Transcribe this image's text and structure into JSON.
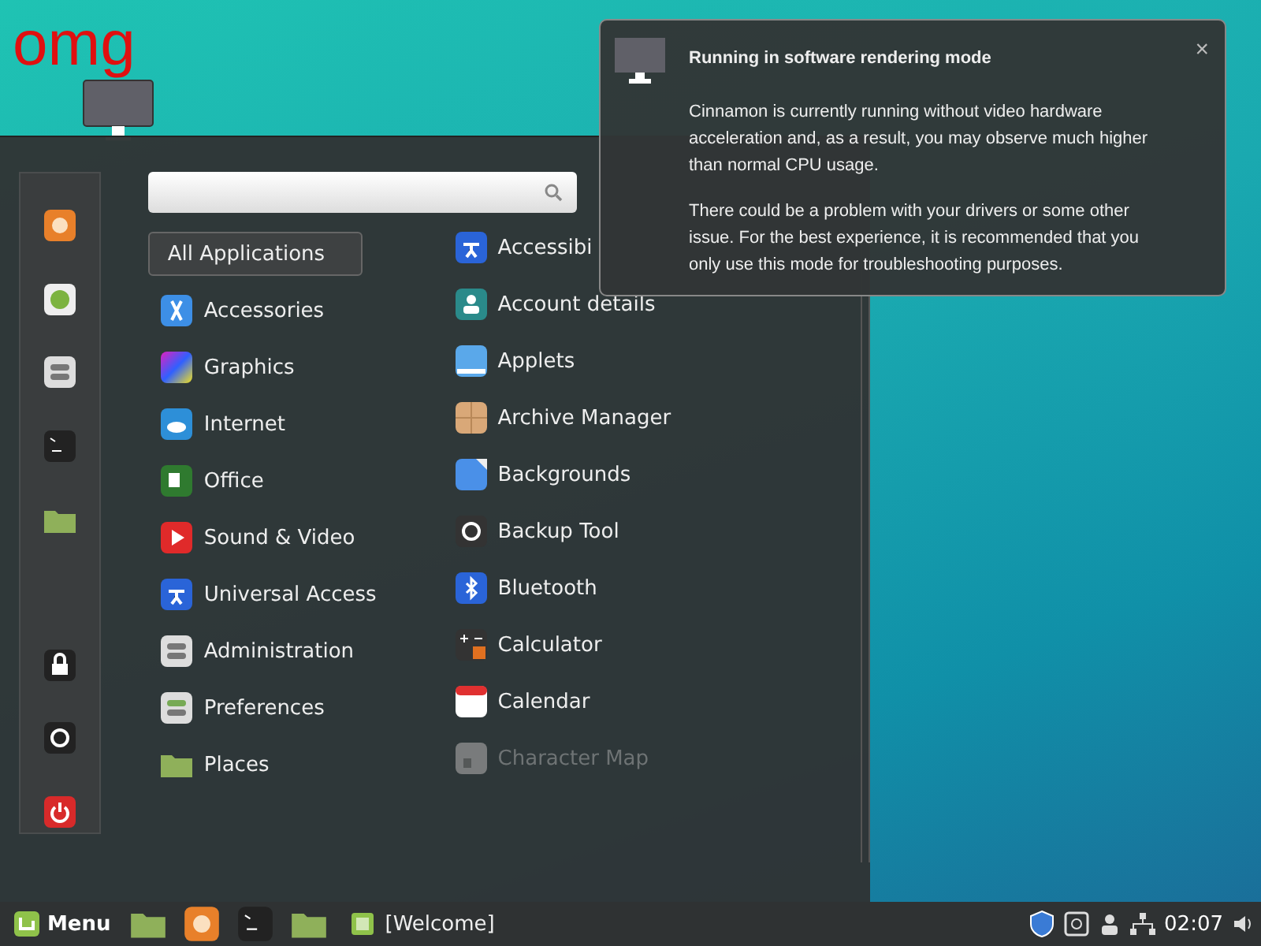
{
  "desktop": {
    "text": "omg"
  },
  "menu": {
    "categories": [
      {
        "label": "All Applications",
        "selected": true
      },
      {
        "label": "Accessories",
        "selected": false
      },
      {
        "label": "Graphics",
        "selected": false
      },
      {
        "label": "Internet",
        "selected": false
      },
      {
        "label": "Office",
        "selected": false
      },
      {
        "label": "Sound & Video",
        "selected": false
      },
      {
        "label": "Universal Access",
        "selected": false
      },
      {
        "label": "Administration",
        "selected": false
      },
      {
        "label": "Preferences",
        "selected": false
      },
      {
        "label": "Places",
        "selected": false
      }
    ],
    "apps": [
      {
        "label": "Accessibi",
        "dimmed": false
      },
      {
        "label": "Account details",
        "dimmed": false
      },
      {
        "label": "Applets",
        "dimmed": false
      },
      {
        "label": "Archive Manager",
        "dimmed": false
      },
      {
        "label": "Backgrounds",
        "dimmed": false
      },
      {
        "label": "Backup Tool",
        "dimmed": false
      },
      {
        "label": "Bluetooth",
        "dimmed": false
      },
      {
        "label": "Calculator",
        "dimmed": false
      },
      {
        "label": "Calendar",
        "dimmed": false
      },
      {
        "label": "Character Map",
        "dimmed": true
      }
    ]
  },
  "notification": {
    "title": "Running in software rendering mode",
    "close": "×",
    "paragraphs": [
      "Cinnamon is currently running without video hardware acceleration and, as a result, you may observe much higher than normal CPU usage.",
      "There could be a problem with your drivers or some other issue.  For the best experience, it is recommended that you only use this mode for troubleshooting purposes."
    ]
  },
  "taskbar": {
    "menu_label": "Menu",
    "windows": [
      {
        "label": "[Welcome]"
      }
    ],
    "clock": "02:07"
  }
}
